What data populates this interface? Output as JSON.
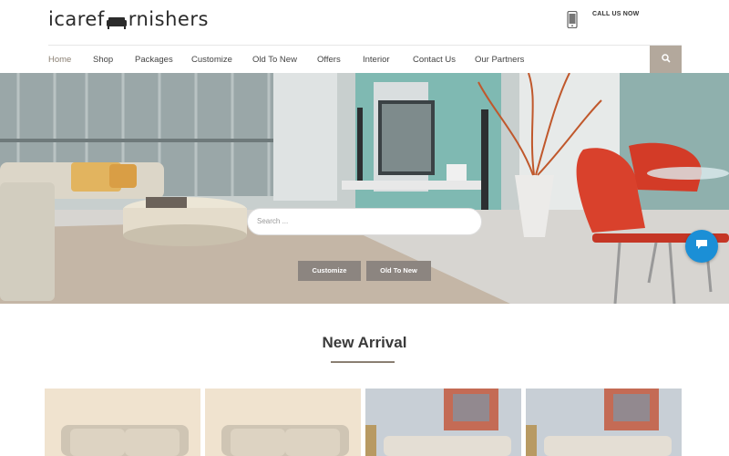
{
  "brand": {
    "logo_text_before": "icaref",
    "logo_text_after": "rnishers"
  },
  "header": {
    "call_label": "CALL US NOW"
  },
  "nav": {
    "items": [
      {
        "label": "Home",
        "active": true
      },
      {
        "label": "Shop",
        "active": false
      },
      {
        "label": "Packages",
        "active": false
      },
      {
        "label": "Customize",
        "active": false
      },
      {
        "label": "Old To New",
        "active": false
      },
      {
        "label": "Offers",
        "active": false
      },
      {
        "label": "Interior",
        "active": false
      },
      {
        "label": "Contact Us",
        "active": false
      },
      {
        "label": "Our Partners",
        "active": false
      }
    ],
    "search_icon": "search-icon"
  },
  "hero": {
    "search_placeholder": "Search ...",
    "buttons": [
      {
        "label": "Customize"
      },
      {
        "label": "Old To New"
      }
    ]
  },
  "section": {
    "title": "New Arrival"
  },
  "colors": {
    "accent": "#8a7f72",
    "nav_search_bg": "#b3a89c",
    "chat": "#1b8fd6",
    "hero_button": "#8c8580"
  },
  "icons": [
    "sofa-logo-icon",
    "phone-icon",
    "search-icon",
    "chat-icon"
  ]
}
